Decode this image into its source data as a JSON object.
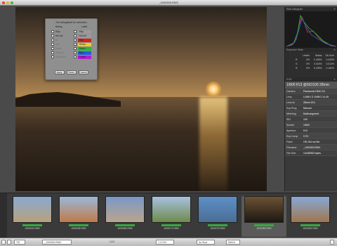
{
  "window": {
    "title": "_1000300.RW2"
  },
  "dialog": {
    "title": "Set rating/label for selection",
    "rating_header": "Rating",
    "label_header": "Label",
    "ratings": [
      "Skip",
      "Not set",
      "☆",
      "☆☆",
      "☆☆☆",
      "☆☆☆☆",
      "☆☆☆☆☆"
    ],
    "labels": [
      {
        "text": "Skip",
        "color": "#9a9a9a"
      },
      {
        "text": "Not set",
        "color": "#9a9a9a"
      },
      {
        "text": "Red",
        "color": "#d82020"
      },
      {
        "text": "Yellow",
        "color": "#e8d020"
      },
      {
        "text": "Green",
        "color": "#28b838"
      },
      {
        "text": "Blue",
        "color": "#2858e0"
      },
      {
        "text": "Purple",
        "color": "#b020c8"
      }
    ],
    "buttons": {
      "apply": "Apply",
      "reset": "Reset",
      "cancel": "Cancel"
    }
  },
  "histogram": {
    "title": "Raw histogram"
  },
  "exposure": {
    "title": "Exposure Stats",
    "headers": [
      "",
      "Undex",
      "Status",
      "Ok-Over"
    ],
    "rows": [
      [
        "R",
        "0%",
        "0.435%",
        "0.443%"
      ],
      [
        "G",
        "0%",
        "0.015%",
        "0.013%"
      ],
      [
        "B",
        "0%",
        "0.159%",
        "0.150%"
      ]
    ]
  },
  "exif": {
    "title": "EXIF",
    "summary": "1/800 f/13 @ISO100 28mm",
    "rows": [
      [
        "Camera",
        "Panasonic DMC-G1"
      ],
      [
        "Lens",
        "LUMIX G VARIO 14-45"
      ],
      [
        "Lens at",
        "28mm f/13"
      ],
      [
        "Exp.Prog",
        "Manual"
      ],
      [
        "Metering",
        "Multi-segment"
      ],
      [
        "ISO",
        "100"
      ],
      [
        "Shutter",
        "1/800"
      ],
      [
        "Aperture",
        "f/13"
      ],
      [
        "Exp.Comp",
        "0 EV"
      ],
      [
        "Flash",
        "Off, Did not fire"
      ],
      [
        "Filename",
        "_1000300.RW2"
      ],
      [
        "File Size",
        "14438352 bytes"
      ]
    ]
  },
  "thumbs": [
    {
      "name": "1000161.RW2",
      "colors": [
        "#8aa9d2",
        "#b6a27a"
      ]
    },
    {
      "name": "1000165.RW2",
      "colors": [
        "#9ab8d8",
        "#c07a4a"
      ]
    },
    {
      "name": "1000082.RW2",
      "colors": [
        "#7a98c8",
        "#b9a58c"
      ]
    },
    {
      "name": "1000171.RW2",
      "colors": [
        "#a7c2e0",
        "#6f8a4c"
      ]
    },
    {
      "name": "1000273.RW2",
      "colors": [
        "#5d8fc7",
        "#4a6e95"
      ]
    },
    {
      "name": "1000280.RW2",
      "colors": [
        "#6b5234",
        "#1e1812"
      ]
    },
    {
      "name": "1000281.RW2",
      "colors": [
        "#86a8d6",
        "#a1764c"
      ]
    }
  ],
  "bottom": {
    "zoom": "7/8",
    "filename": "_1000300.RW2",
    "mode": "LCH",
    "exposure": "1.13 EV",
    "wb": "As Shot",
    "temp": "5601K"
  }
}
